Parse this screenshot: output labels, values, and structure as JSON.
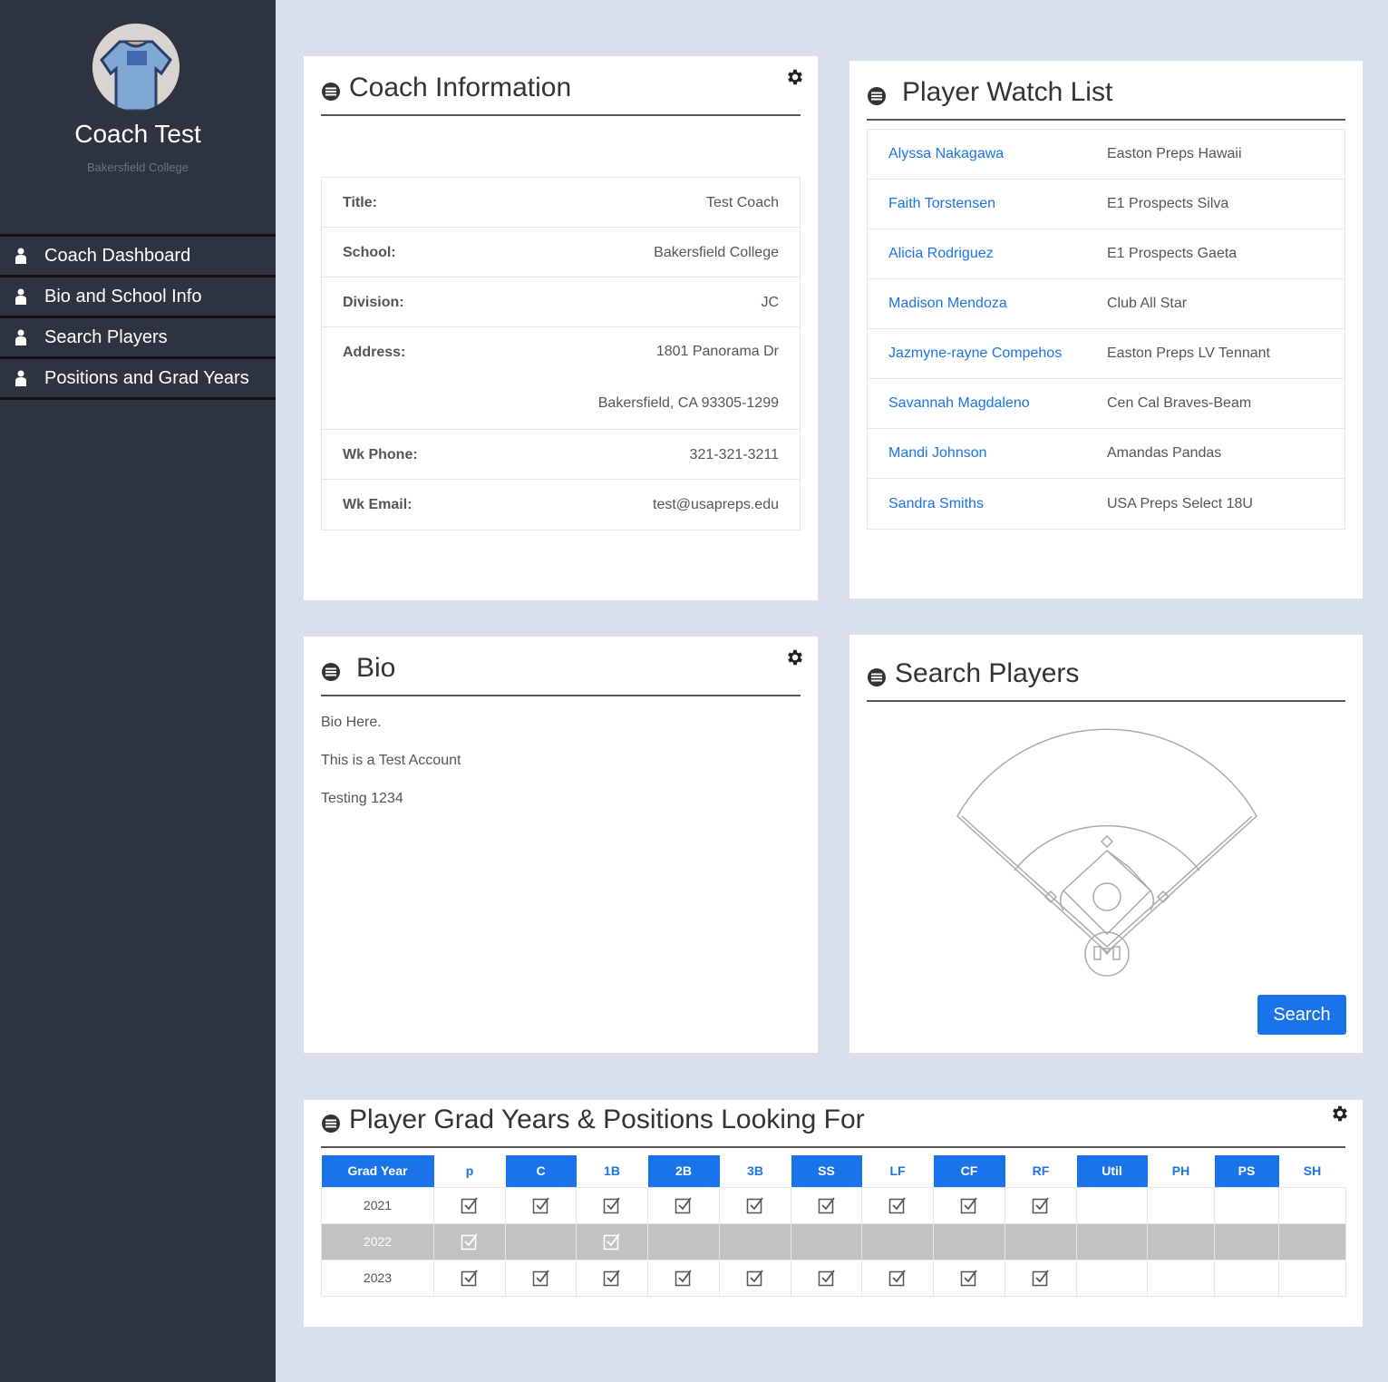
{
  "sidebar": {
    "profile": {
      "name": "Coach Test",
      "school": "Bakersfield College"
    },
    "nav": [
      {
        "label": "Coach Dashboard"
      },
      {
        "label": "Bio and School Info"
      },
      {
        "label": "Search Players"
      },
      {
        "label": "Positions and Grad Years"
      }
    ]
  },
  "coach_info": {
    "title": "Coach Information",
    "rows": {
      "title": {
        "label": "Title:",
        "value": "Test Coach"
      },
      "school": {
        "label": "School:",
        "value": "Bakersfield College"
      },
      "division": {
        "label": "Division:",
        "value": "JC"
      },
      "address": {
        "label": "Address:",
        "line1": "1801 Panorama Dr",
        "line2": "Bakersfield, CA 93305-1299"
      },
      "phone": {
        "label": "Wk Phone:",
        "value": "321-321-3211"
      },
      "email": {
        "label": "Wk Email:",
        "value": "test@usapreps.edu"
      }
    }
  },
  "watch_list": {
    "title": "Player Watch List",
    "players": [
      {
        "name": "Alyssa Nakagawa",
        "team": "Easton Preps Hawaii"
      },
      {
        "name": "Faith Torstensen",
        "team": "E1 Prospects Silva"
      },
      {
        "name": "Alicia Rodriguez",
        "team": "E1 Prospects Gaeta"
      },
      {
        "name": "Madison Mendoza",
        "team": "Club All Star"
      },
      {
        "name": "Jazmyne-rayne Compehos",
        "team": "Easton Preps LV Tennant"
      },
      {
        "name": "Savannah Magdaleno",
        "team": "Cen Cal Braves-Beam"
      },
      {
        "name": "Mandi Johnson",
        "team": "Amandas Pandas"
      },
      {
        "name": "Sandra Smiths",
        "team": "USA Preps Select 18U"
      }
    ]
  },
  "bio": {
    "title": "Bio",
    "lines": [
      "Bio Here.",
      "This is a Test Account",
      "Testing 1234"
    ]
  },
  "search": {
    "title": "Search Players",
    "button": "Search"
  },
  "grad_positions": {
    "title": "Player Grad Years & Positions Looking For",
    "headers": [
      "Grad Year",
      "p",
      "C",
      "1B",
      "2B",
      "3B",
      "SS",
      "LF",
      "CF",
      "RF",
      "Util",
      "PH",
      "PS",
      "SH"
    ],
    "rows": [
      {
        "year": "2021",
        "checks": [
          true,
          true,
          true,
          true,
          true,
          true,
          true,
          true,
          true,
          false,
          false,
          false,
          false
        ]
      },
      {
        "year": "2022",
        "checks": [
          true,
          false,
          true,
          false,
          false,
          false,
          false,
          false,
          false,
          false,
          false,
          false,
          false
        ]
      },
      {
        "year": "2023",
        "checks": [
          true,
          true,
          true,
          true,
          true,
          true,
          true,
          true,
          true,
          false,
          false,
          false,
          false
        ]
      }
    ]
  },
  "colors": {
    "accent": "#1a73e8",
    "sidebar": "#2d333f",
    "background": "#d9e0ec",
    "shaded_row": "#c2c2c2"
  },
  "icons": {
    "panel": "circle-menu-icon",
    "settings": "gear-icon",
    "nav": "user-icon",
    "checkbox": "checked-box-icon"
  }
}
